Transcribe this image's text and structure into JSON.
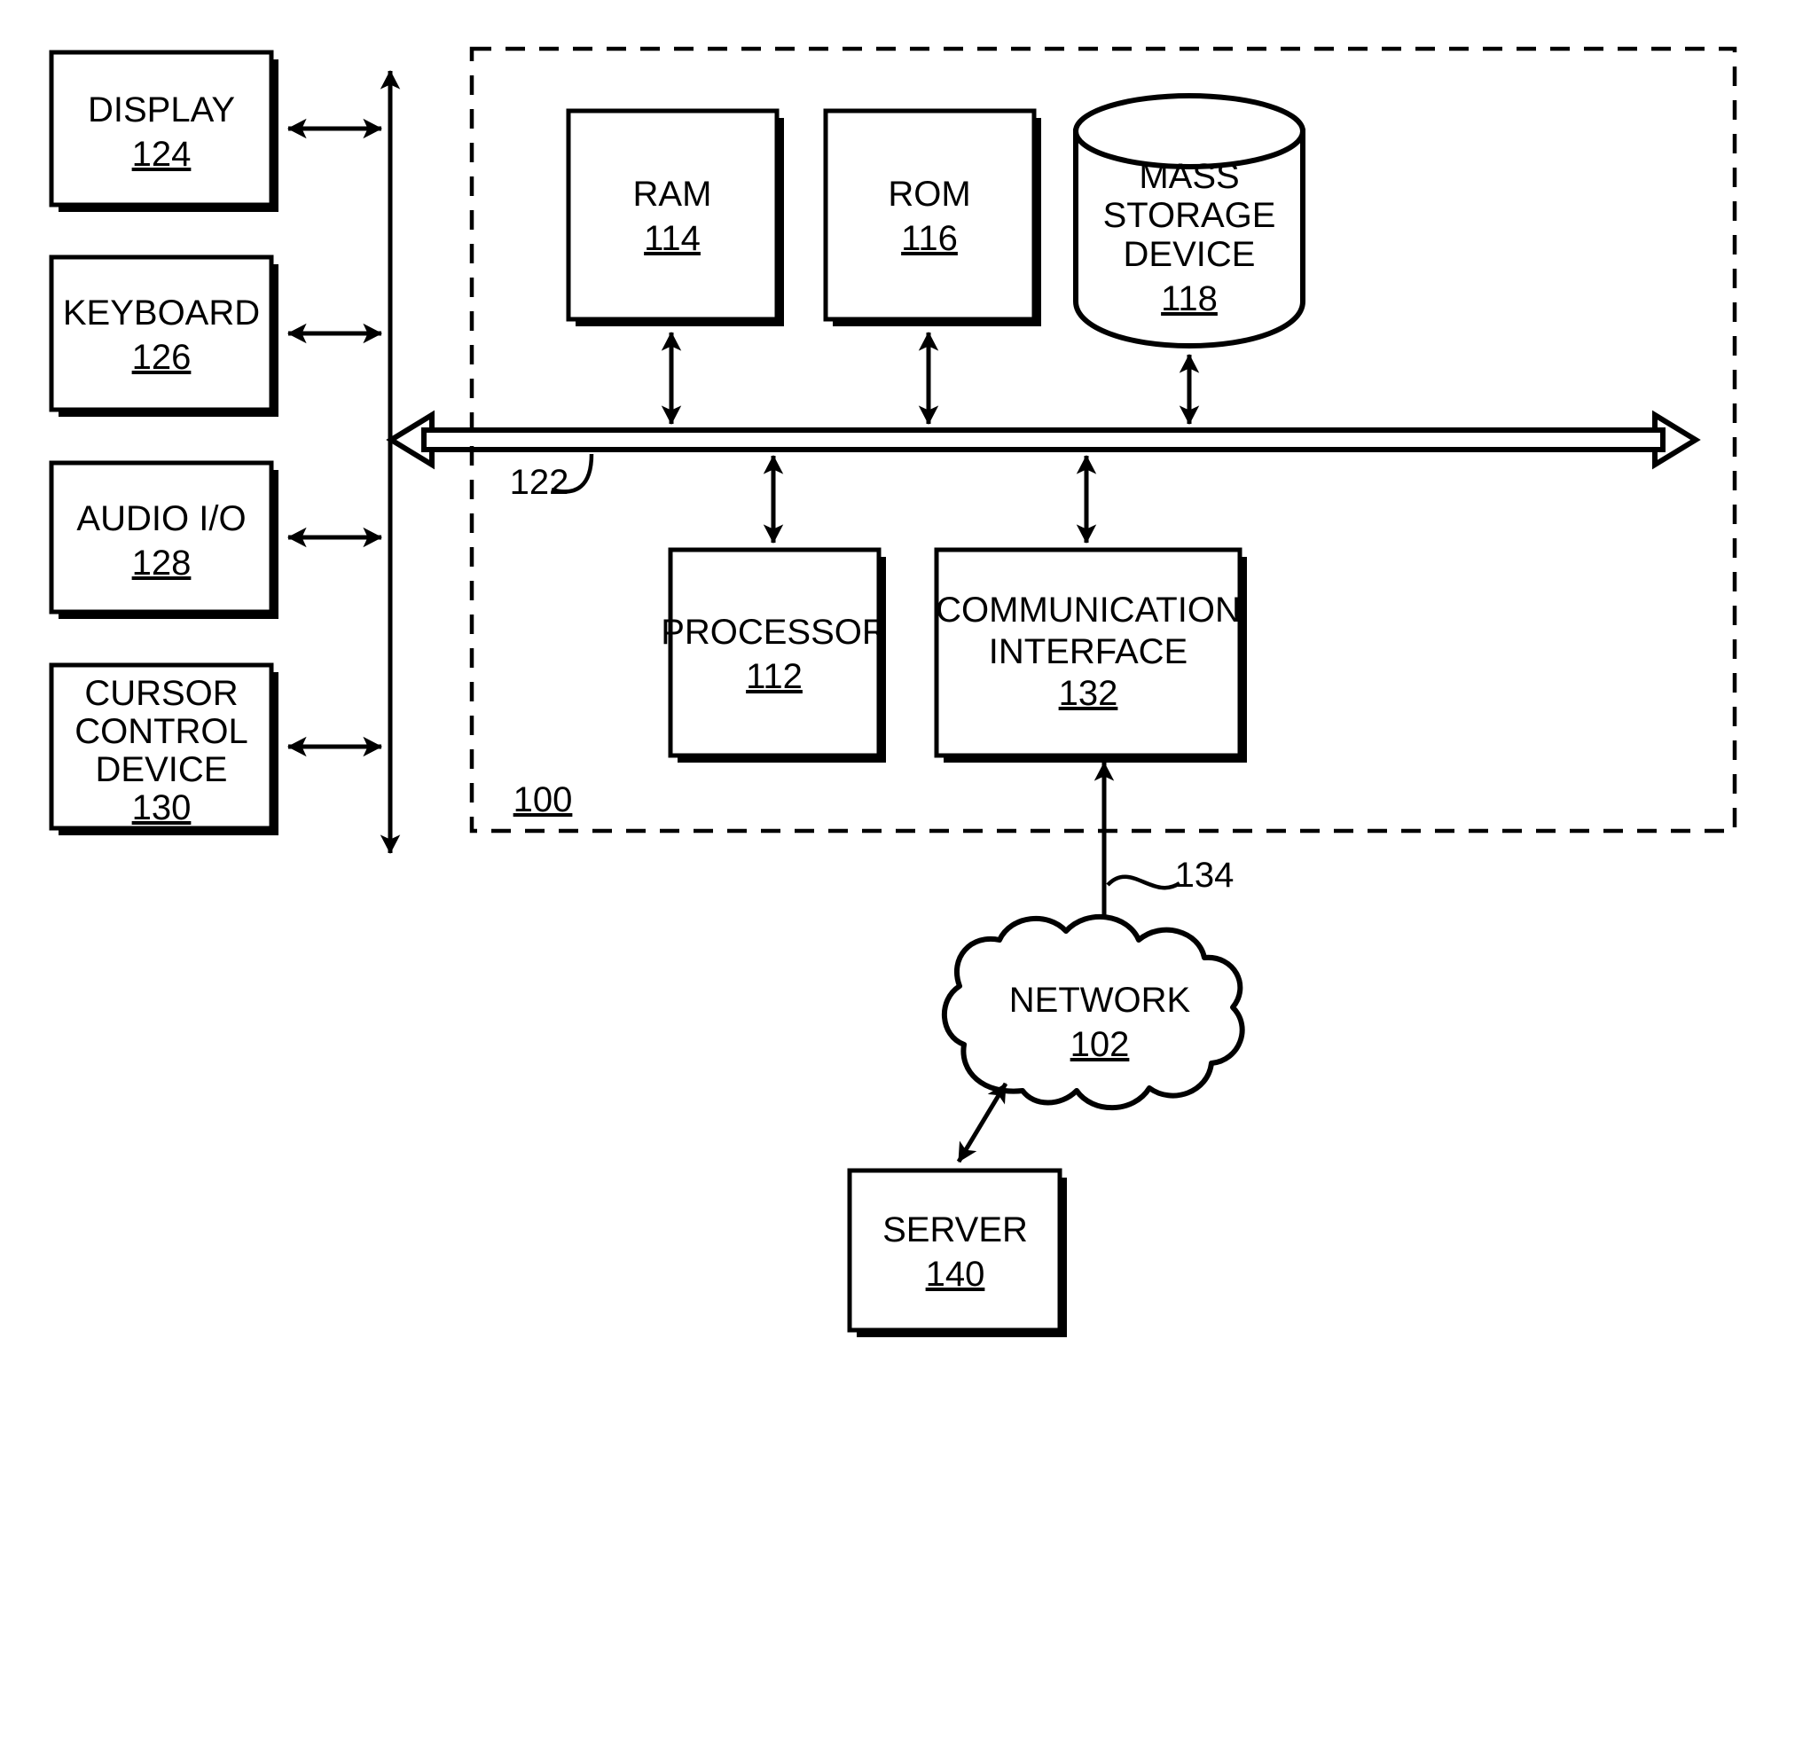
{
  "figure": {
    "kind": "patent-block-diagram",
    "system_label": "100",
    "bus_label": "122",
    "network_link_label": "134",
    "stroke_color": "#000000",
    "background_color": "#ffffff"
  },
  "peripherals": [
    {
      "name": "display",
      "label": "DISPLAY",
      "ref": "124"
    },
    {
      "name": "keyboard",
      "label": "KEYBOARD",
      "ref": "126"
    },
    {
      "name": "audio-io",
      "label": "AUDIO I/O",
      "ref": "128"
    },
    {
      "name": "cursor-control-device",
      "label_line1": "CURSOR",
      "label_line2": "CONTROL",
      "label_line3": "DEVICE",
      "ref": "130"
    }
  ],
  "memory": {
    "ram": {
      "label": "RAM",
      "ref": "114"
    },
    "rom": {
      "label": "ROM",
      "ref": "116"
    },
    "mass_storage": {
      "label_line1": "MASS",
      "label_line2": "STORAGE",
      "label_line3": "DEVICE",
      "ref": "118"
    }
  },
  "compute": {
    "processor": {
      "label": "PROCESSOR",
      "ref": "112"
    },
    "communication_interface": {
      "label_line1": "COMMUNICATION",
      "label_line2": "INTERFACE",
      "ref": "132"
    }
  },
  "external": {
    "network": {
      "label": "NETWORK",
      "ref": "102"
    },
    "server": {
      "label": "SERVER",
      "ref": "140"
    }
  }
}
